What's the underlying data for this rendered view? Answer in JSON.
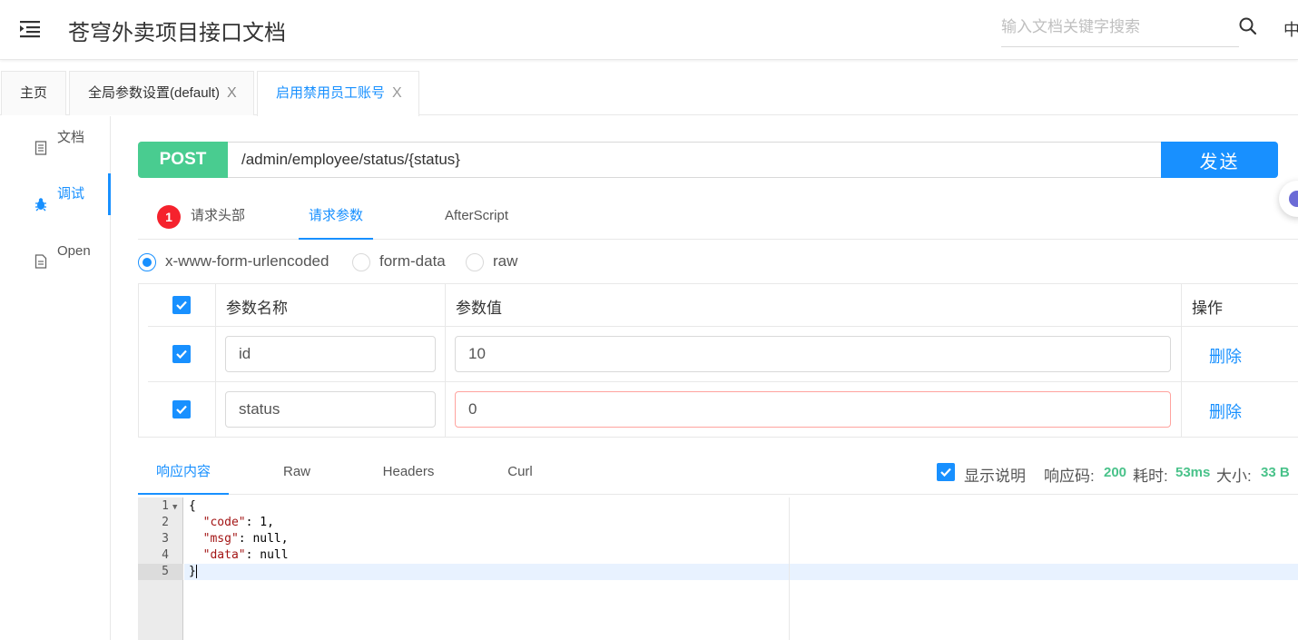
{
  "header": {
    "title": "苍穹外卖项目接口文档",
    "search_placeholder": "输入文档关键字搜索",
    "lang": "中"
  },
  "tabs": [
    {
      "label": "主页"
    },
    {
      "label": "全局参数设置(default)",
      "close": "X"
    },
    {
      "label": "启用禁用员工账号",
      "close": "X"
    }
  ],
  "sidenav": {
    "items": [
      {
        "label": "文档",
        "icon": "document-icon"
      },
      {
        "label": "调试",
        "icon": "bug-icon"
      },
      {
        "label": "Open",
        "icon": "file-icon"
      }
    ]
  },
  "request": {
    "method": "POST",
    "url": "/admin/employee/status/{status}",
    "send_label": "发送"
  },
  "subtabs": {
    "badge": "1",
    "headers": "请求头部",
    "params": "请求参数",
    "afterscript": "AfterScript"
  },
  "body_types": {
    "urlencoded": "x-www-form-urlencoded",
    "formdata": "form-data",
    "raw": "raw"
  },
  "params_table": {
    "col_name": "参数名称",
    "col_value": "参数值",
    "col_action": "操作",
    "rows": [
      {
        "name": "id",
        "value": "10",
        "action": "删除"
      },
      {
        "name": "status",
        "value": "0",
        "action": "删除"
      }
    ]
  },
  "response": {
    "tabs": [
      "响应内容",
      "Raw",
      "Headers",
      "Curl"
    ],
    "show_desc": "显示说明",
    "code_label": "响应码:",
    "code_value": "200",
    "time_label": "耗时:",
    "time_value": "53ms",
    "size_label": "大小:",
    "size_value": "33 B"
  },
  "code": {
    "line_numbers": [
      "1",
      "2",
      "3",
      "4",
      "5"
    ],
    "lines": [
      {
        "text": "{"
      },
      {
        "key": "\"code\"",
        "rest": ": 1,"
      },
      {
        "key": "\"msg\"",
        "rest": ": null,"
      },
      {
        "key": "\"data\"",
        "rest": ": null"
      },
      {
        "text": "}"
      }
    ]
  },
  "colors": {
    "accent": "#1890ff",
    "post_method": "#49cc90",
    "badge": "#f5222d",
    "status_value": "#49c28a"
  }
}
